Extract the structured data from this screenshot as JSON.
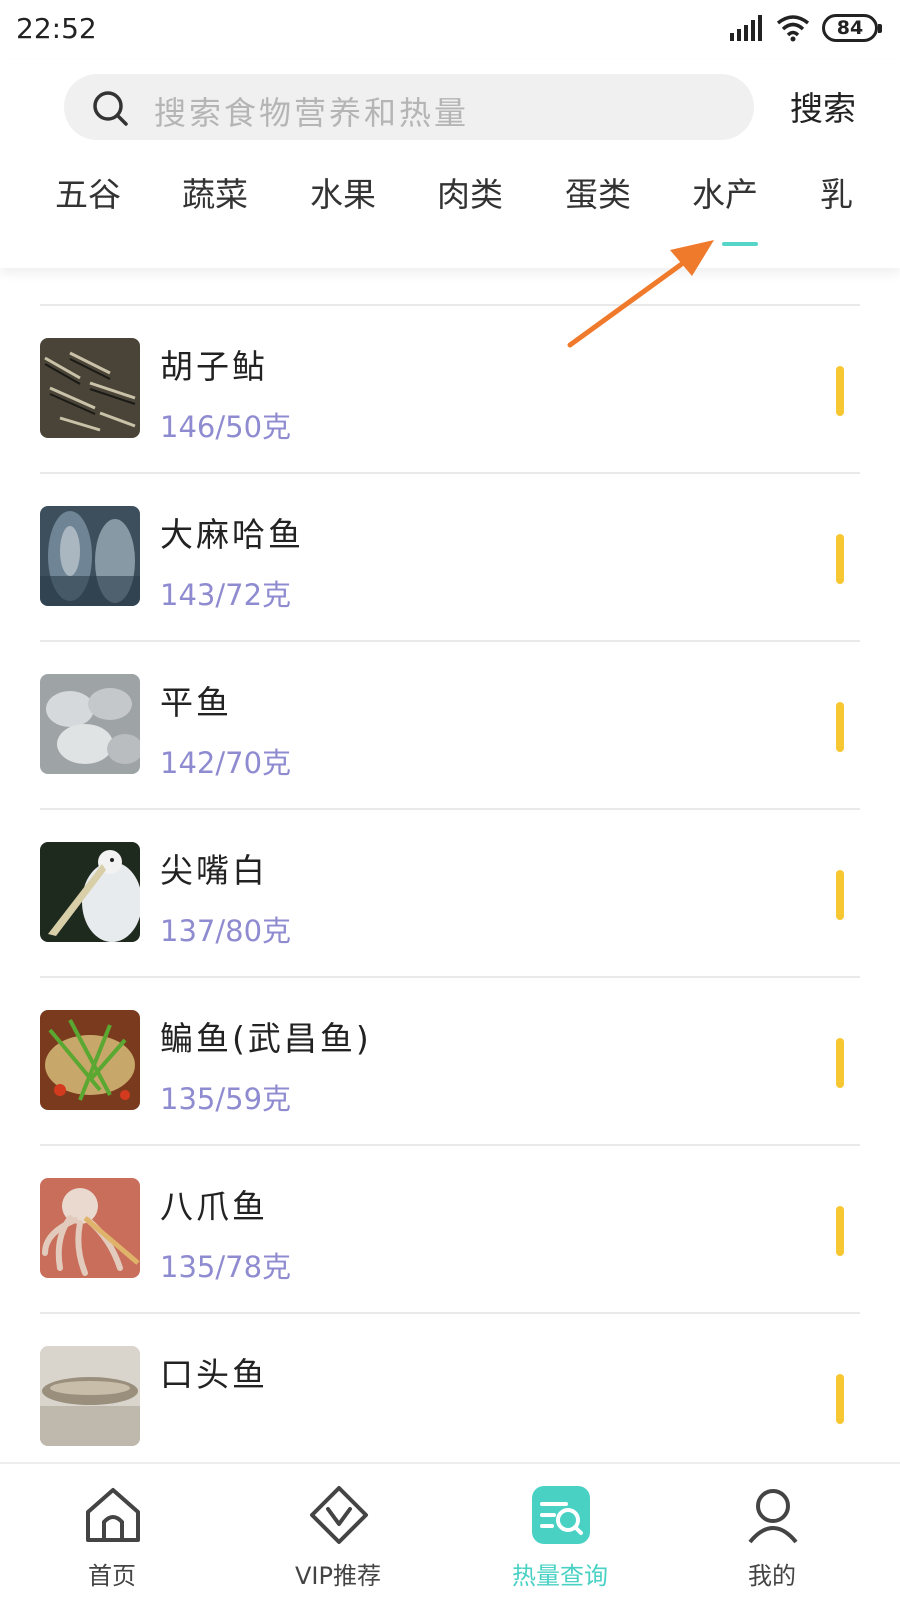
{
  "status_bar": {
    "time": "22:52",
    "battery": "84"
  },
  "search": {
    "placeholder": "搜索食物营养和热量",
    "button_label": "搜索"
  },
  "tabs": [
    {
      "label": "五谷"
    },
    {
      "label": "蔬菜"
    },
    {
      "label": "水果"
    },
    {
      "label": "肉类"
    },
    {
      "label": "蛋类"
    },
    {
      "label": "水产"
    },
    {
      "label": "乳"
    }
  ],
  "active_tab": "水产",
  "foods": [
    {
      "name": "胡子鲇",
      "calories": "146/50克"
    },
    {
      "name": "大麻哈鱼",
      "calories": "143/72克"
    },
    {
      "name": "平鱼",
      "calories": "142/70克"
    },
    {
      "name": "尖嘴白",
      "calories": "137/80克"
    },
    {
      "name": "鳊鱼(武昌鱼)",
      "calories": "135/59克"
    },
    {
      "name": "八爪鱼",
      "calories": "135/78克"
    },
    {
      "name": "口头鱼",
      "calories": ""
    }
  ],
  "bottom_nav": [
    {
      "label": "首页",
      "icon": "home-icon"
    },
    {
      "label": "VIP推荐",
      "icon": "vip-icon"
    },
    {
      "label": "热量查询",
      "icon": "calorie-search-icon"
    },
    {
      "label": "我的",
      "icon": "profile-icon"
    }
  ],
  "colors": {
    "accent": "#49d1c4",
    "calorie_text": "#8f8bd0",
    "bar": "#f7c731",
    "annotation_arrow": "#f07a2c"
  }
}
